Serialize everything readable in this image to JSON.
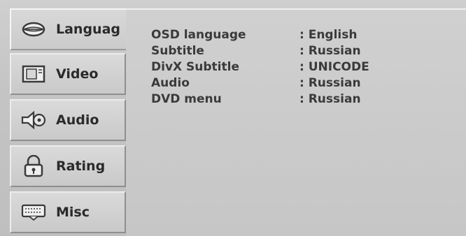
{
  "sidebar": {
    "items": [
      {
        "label": "Languag",
        "icon": "lips-icon",
        "active": true
      },
      {
        "label": "Video",
        "icon": "monitor-icon",
        "active": false
      },
      {
        "label": "Audio",
        "icon": "speaker-icon",
        "active": false
      },
      {
        "label": "Rating",
        "icon": "padlock-icon",
        "active": false
      },
      {
        "label": "Misc",
        "icon": "keyboard-icon",
        "active": false
      }
    ]
  },
  "settings": {
    "rows": [
      {
        "name": "OSD language",
        "value": ": English"
      },
      {
        "name": "Subtitle",
        "value": ": Russian"
      },
      {
        "name": "DivX Subtitle",
        "value": ": UNICODE"
      },
      {
        "name": "Audio",
        "value": ": Russian"
      },
      {
        "name": "DVD menu",
        "value": ": Russian"
      }
    ]
  },
  "colors": {
    "background": "#bdbdbd",
    "text": "#2a2a2a",
    "tab_face": "#d3d3d3"
  }
}
